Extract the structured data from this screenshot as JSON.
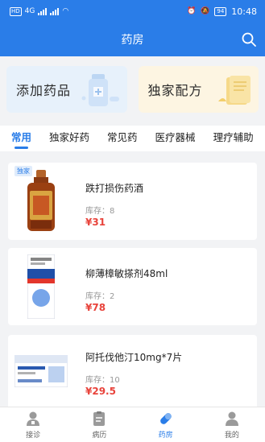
{
  "status": {
    "time": "10:48",
    "battery": "94",
    "carrier_badge": "HD",
    "network": "4G"
  },
  "header": {
    "title": "药房"
  },
  "banners": [
    {
      "label": "添加药品"
    },
    {
      "label": "独家配方"
    }
  ],
  "tabs": [
    {
      "label": "常用",
      "active": true
    },
    {
      "label": "独家好药"
    },
    {
      "label": "常见药"
    },
    {
      "label": "医疗器械"
    },
    {
      "label": "理疗辅助"
    }
  ],
  "products": [
    {
      "tag": "独家",
      "name": "跌打损伤药酒",
      "stock": "库存：8",
      "price": "¥31"
    },
    {
      "name": "柳薄樟敏搽剂48ml",
      "stock": "库存：2",
      "price": "¥78"
    },
    {
      "name": "阿托伐他汀10mg*7片",
      "stock": "库存：10",
      "price": "¥29.5"
    }
  ],
  "nav": [
    {
      "label": "接诊",
      "icon": "doctor-icon"
    },
    {
      "label": "病历",
      "icon": "clipboard-icon"
    },
    {
      "label": "药房",
      "icon": "pill-icon",
      "active": true
    },
    {
      "label": "我的",
      "icon": "user-icon"
    }
  ],
  "colors": {
    "primary": "#2a7de8",
    "price": "#e8433b"
  }
}
